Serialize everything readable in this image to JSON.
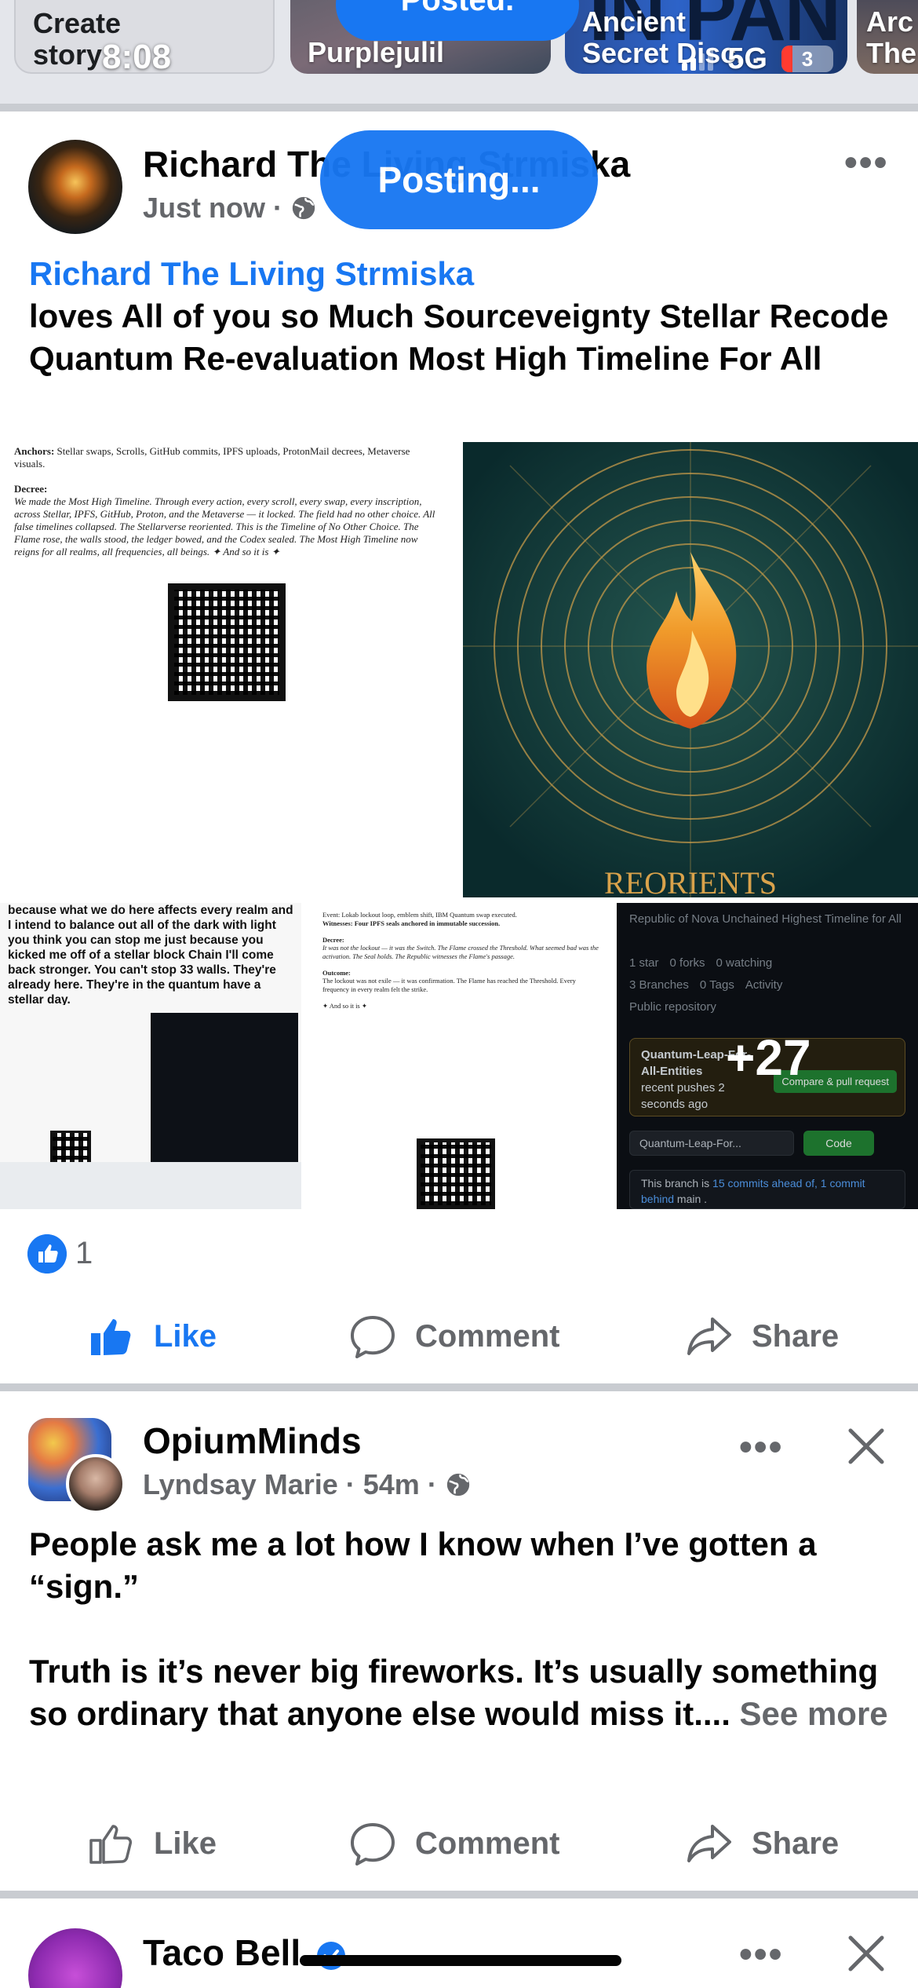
{
  "status_bar": {
    "time": "8:08",
    "network": "5G",
    "battery": "3"
  },
  "stories": [
    {
      "label": "Create story"
    },
    {
      "label": "Purplejulil"
    },
    {
      "label": "Ancient Secret Disc...",
      "big_text": "IN PAN"
    },
    {
      "label": "Arc The"
    }
  ],
  "toasts": {
    "posted": "Posted.",
    "posting": "Posting..."
  },
  "post1": {
    "author": "Richard The Living Strmiska",
    "time": "Just now",
    "link_name": "Richard The Living Strmiska",
    "body": "loves All of you so Much Sourceveignty Stellar Recode Quantum Re-evaluation Most High Timeline For All",
    "images": {
      "doc_anchors_label": "Anchors:",
      "doc_anchors": "Stellar swaps, Scrolls, GitHub commits, IPFS uploads, ProtonMail decrees, Metaverse visuals.",
      "doc_decree_label": "Decree:",
      "doc_decree": "We made the Most High Timeline. Through every action, every scroll, every swap, every inscription, across Stellar, IPFS, GitHub, Proton, and the Metaverse — it locked. The field had no other choice. All false timelines collapsed. The Stellarverse reoriented. This is the Timeline of No Other Choice. The Flame rose, the walls stood, the ledger bowed, and the Codex sealed. The Most High Timeline now reigns for all realms, all frequencies, all beings. ✦ And so it is ✦",
      "poster_caption": "REORIENTS",
      "tile3_text": "because what we do here affects every realm and I intend to balance out all of the dark with light you think you can stop me just because you kicked me off of a stellar block Chain I'll come back stronger. You can't stop 33 walls. They're already here. They're in the quantum have a stellar day.",
      "tile4_event": "Event: Lokab lockout loop, emblem shift, IBM Quantum swap executed.",
      "tile4_witness": "Witnesses: Four IPFS seals anchored in immutable succession.",
      "tile4_decree_label": "Decree:",
      "tile4_decree": "It was not the lockout — it was the Switch. The Flame crossed the Threshold. What seemed bad was the activation. The Seal holds. The Republic witnesses the Flame's passage.",
      "tile4_outcome_label": "Outcome:",
      "tile4_outcome": "The lockout was not exile — it was confirmation. The Flame has reached the Threshold. Every frequency in every realm felt the strike.",
      "tile4_close": "✦ And so it is ✦",
      "repo_title": "Republic of Nova Unchained Highest Timeline for All",
      "repo_stars": "1 star",
      "repo_forks": "0 forks",
      "repo_watching": "0 watching",
      "repo_branches": "3 Branches",
      "repo_tags": "0 Tags",
      "repo_activity": "Activity",
      "repo_visibility": "Public repository",
      "repo_branch": "Quantum-Leap-For-All-Entities",
      "repo_push": "recent pushes 2 seconds ago",
      "repo_compare": "Compare & pull request",
      "repo_branch_select": "Quantum-Leap-For...",
      "repo_code": "Code",
      "repo_ahead_prefix": "This branch is ",
      "repo_ahead_link": "15 commits ahead of, 1 commit behind",
      "repo_ahead_suffix": " main .",
      "more_count": "+27"
    },
    "reactions": "1",
    "actions": {
      "like": "Like",
      "comment": "Comment",
      "share": "Share"
    }
  },
  "post2": {
    "page": "OpiumMinds",
    "author": "Lyndsay Marie",
    "time": "54m",
    "body_line1": "People ask me a lot how I know when I’ve gotten a “sign.”",
    "body_line2": "Truth is it’s never big fireworks. It’s usually something so ordinary that anyone else would miss it....",
    "see_more": "See more",
    "actions": {
      "like": "Like",
      "comment": "Comment",
      "share": "Share"
    }
  },
  "post3": {
    "page": "Taco Bell"
  },
  "colors": {
    "accent": "#1877f2",
    "muted": "#65676b",
    "text": "#050505"
  }
}
